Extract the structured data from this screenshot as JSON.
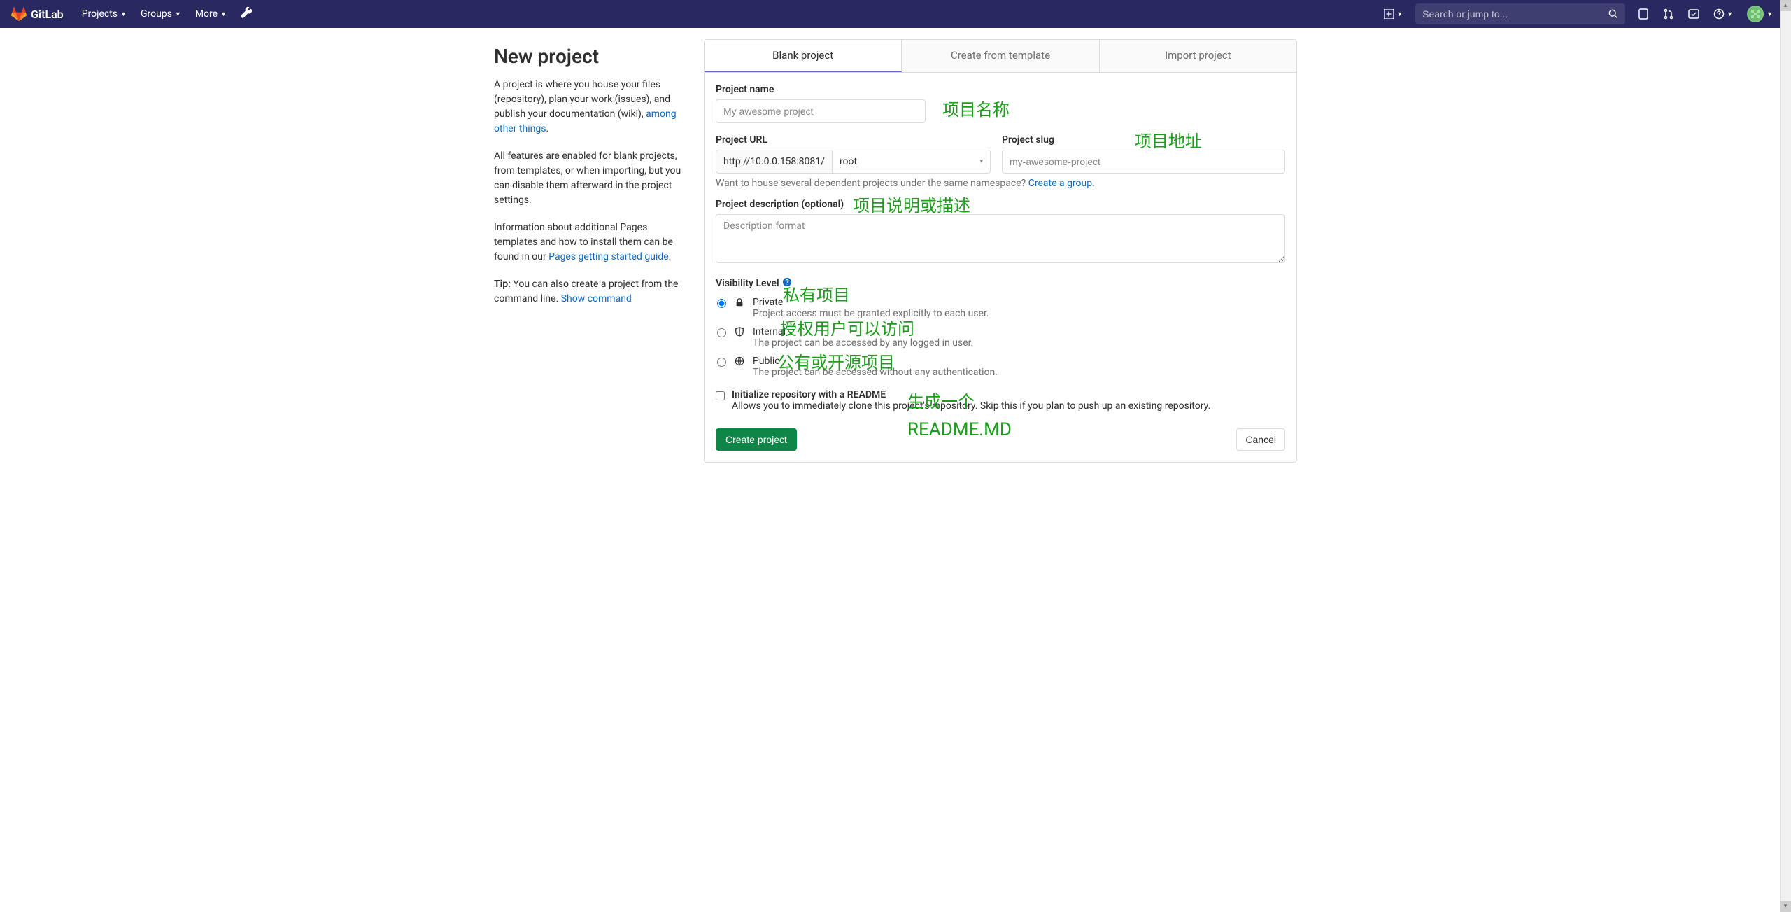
{
  "nav": {
    "brand": "GitLab",
    "projects": "Projects",
    "groups": "Groups",
    "more": "More",
    "search_placeholder": "Search or jump to..."
  },
  "left": {
    "title": "New project",
    "p1_a": "A project is where you house your files (repository), plan your work (issues), and publish your documentation (wiki), ",
    "p1_link": "among other things",
    "p1_b": ".",
    "p2": "All features are enabled for blank projects, from templates, or when importing, but you can disable them afterward in the project settings.",
    "p3_a": "Information about additional Pages templates and how to install them can be found in our ",
    "p3_link": "Pages getting started guide",
    "p3_b": ".",
    "tip_label": "Tip:",
    "tip_a": " You can also create a project from the command line. ",
    "tip_link": "Show command"
  },
  "tabs": {
    "blank": "Blank project",
    "template": "Create from template",
    "import": "Import project"
  },
  "form": {
    "name_label": "Project name",
    "name_placeholder": "My awesome project",
    "url_label": "Project URL",
    "url_base": "http://10.0.0.158:8081/",
    "namespace": "root",
    "slug_label": "Project slug",
    "slug_placeholder": "my-awesome-project",
    "ns_help": "Want to house several dependent projects under the same namespace? ",
    "ns_link": "Create a group.",
    "desc_label": "Project description (optional)",
    "desc_placeholder": "Description format",
    "vis_label": "Visibility Level",
    "vis": {
      "private_title": "Private",
      "private_desc": "Project access must be granted explicitly to each user.",
      "internal_title": "Internal",
      "internal_desc": "The project can be accessed by any logged in user.",
      "public_title": "Public",
      "public_desc": "The project can be accessed without any authentication."
    },
    "readme_title": "Initialize repository with a README",
    "readme_desc": "Allows you to immediately clone this project's repository. Skip this if you plan to push up an existing repository.",
    "create_btn": "Create project",
    "cancel_btn": "Cancel"
  },
  "annotations": {
    "name": "项目名称",
    "url": "项目地址",
    "desc": "项目说明或描述",
    "private": "私有项目",
    "internal": "授权用户可以访问",
    "public": "公有或开源项目",
    "readme1": "生成一个",
    "readme2": "README.MD"
  }
}
